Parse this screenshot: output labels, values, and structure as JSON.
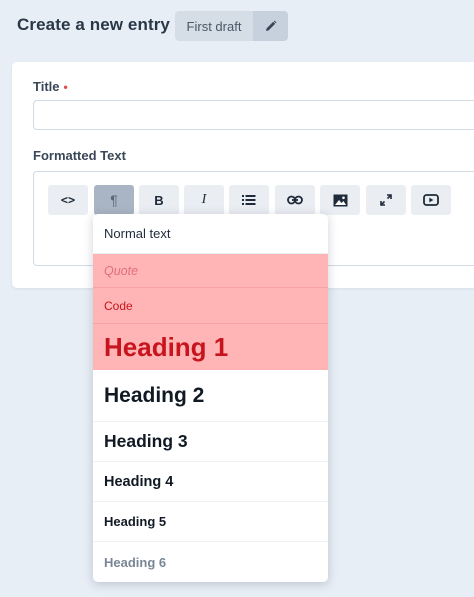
{
  "header": {
    "title": "Create a new entry",
    "status": "First draft",
    "edit_icon": "pencil-icon"
  },
  "form": {
    "title_label": "Title",
    "required_marker": "•",
    "formatted_text_label": "Formatted Text"
  },
  "toolbar": [
    {
      "name": "code-view",
      "icon": "code-brackets-icon",
      "glyph": "<>"
    },
    {
      "name": "paragraph-format",
      "icon": "pilcrow-icon",
      "glyph": "¶",
      "active": true
    },
    {
      "name": "bold",
      "icon": "bold-icon",
      "glyph": "B"
    },
    {
      "name": "italic",
      "icon": "italic-icon",
      "glyph": "I"
    },
    {
      "name": "list",
      "icon": "list-icon",
      "glyph": ""
    },
    {
      "name": "link",
      "icon": "link-icon",
      "glyph": ""
    },
    {
      "name": "image",
      "icon": "image-icon",
      "glyph": ""
    },
    {
      "name": "fullscreen",
      "icon": "expand-icon",
      "glyph": ""
    },
    {
      "name": "video",
      "icon": "video-icon",
      "glyph": ""
    }
  ],
  "format_menu": {
    "items": [
      {
        "label": "Normal text",
        "highlighted": false
      },
      {
        "label": "Quote",
        "highlighted": true
      },
      {
        "label": "Code",
        "highlighted": true
      },
      {
        "label": "Heading 1",
        "highlighted": true
      },
      {
        "label": "Heading 2",
        "highlighted": false
      },
      {
        "label": "Heading 3",
        "highlighted": false
      },
      {
        "label": "Heading 4",
        "highlighted": false
      },
      {
        "label": "Heading 5",
        "highlighted": false
      },
      {
        "label": "Heading 6",
        "highlighted": false
      }
    ]
  },
  "colors": {
    "highlight": "#ffb5b5",
    "highlight_text": "#c8141e",
    "required": "#e04b4b"
  }
}
